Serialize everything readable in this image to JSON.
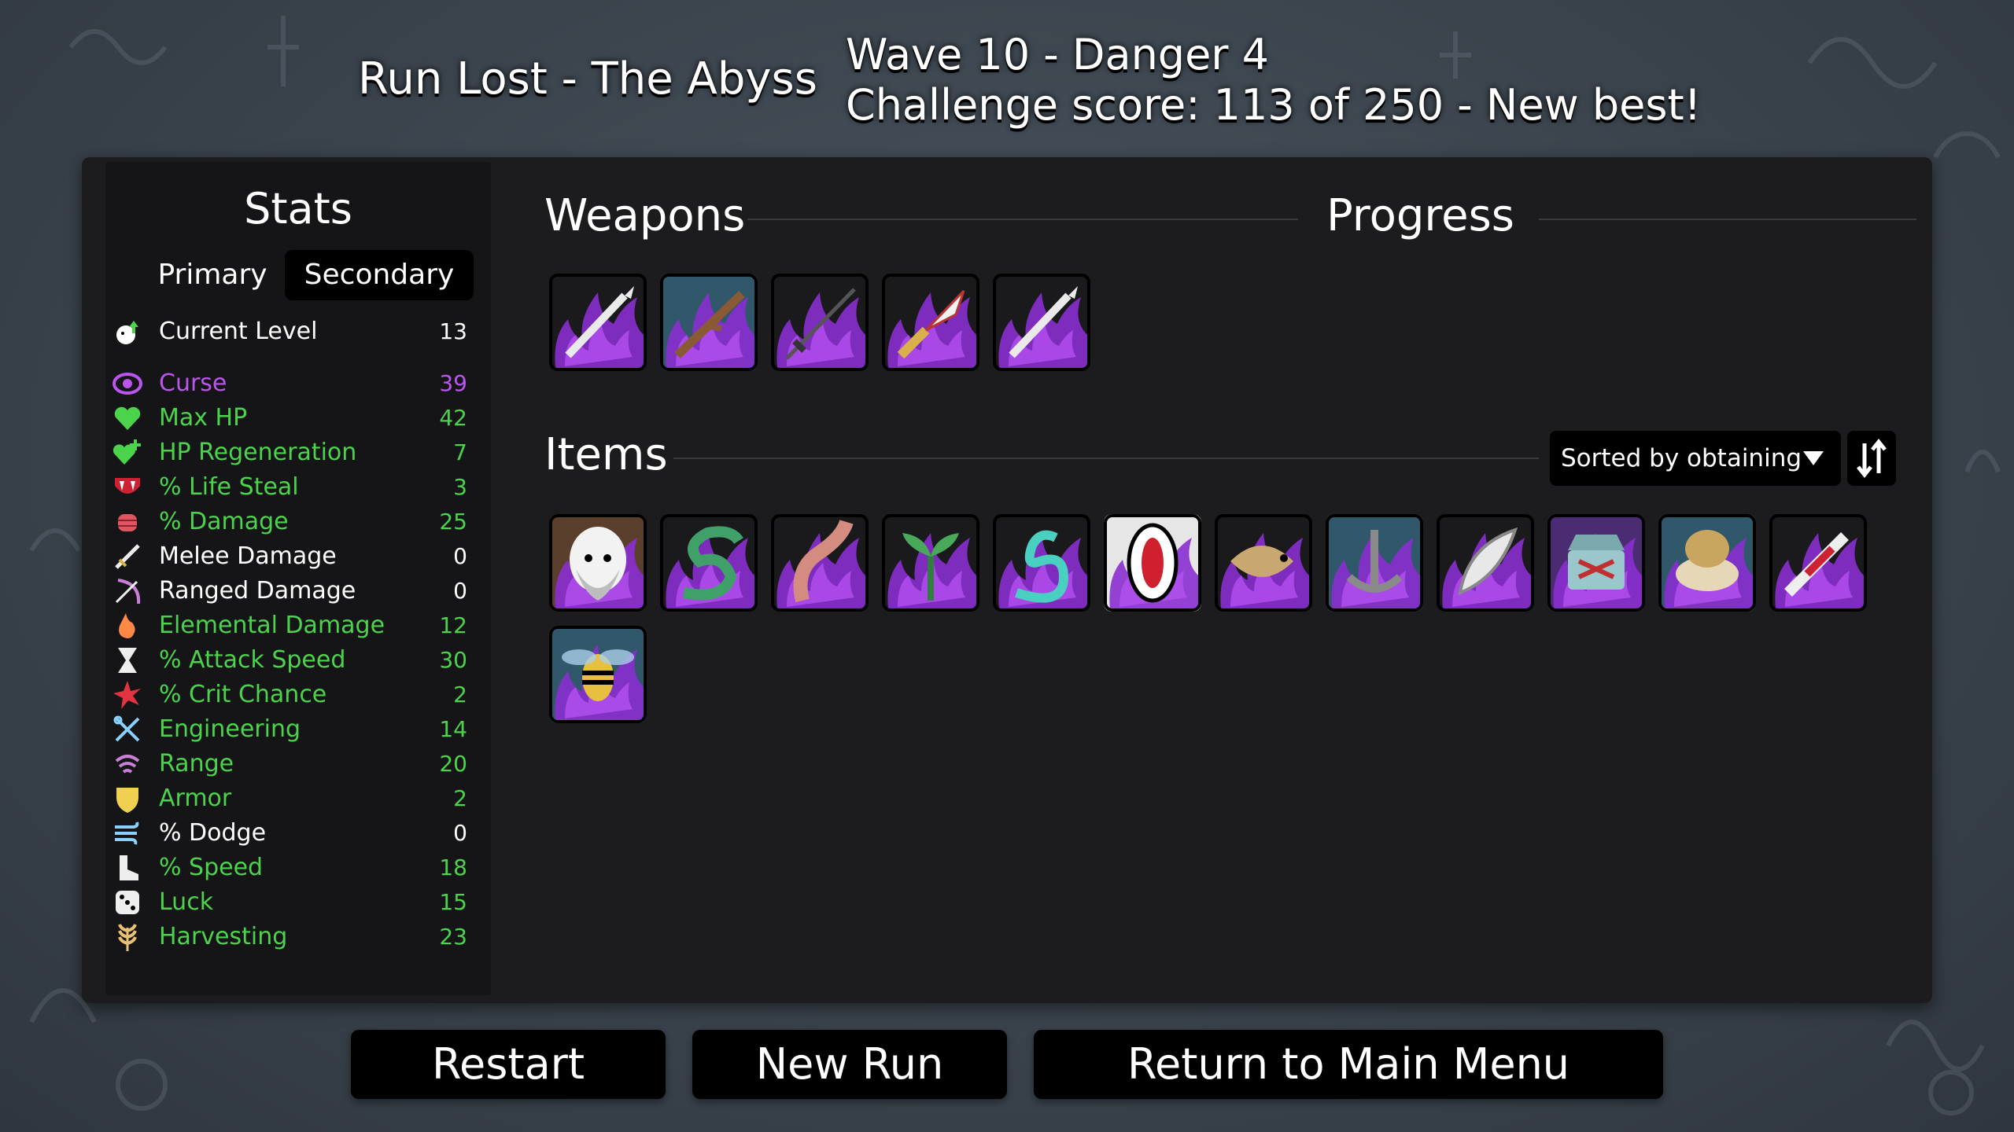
{
  "header": {
    "run_status": "Run Lost - The Abyss",
    "wave_line": "Wave 10 - Danger 4",
    "challenge_line": "Challenge score: 113 of 250 - New best!"
  },
  "stats": {
    "title": "Stats",
    "tabs": [
      {
        "label": "Primary",
        "selected": false
      },
      {
        "label": "Secondary",
        "selected": true
      }
    ],
    "rows": [
      {
        "label": "Current Level",
        "value": "13",
        "color": "white",
        "icon": "level-up-icon"
      },
      {
        "label": "Curse",
        "value": "39",
        "color": "purple",
        "icon": "curse-eye-icon"
      },
      {
        "label": "Max HP",
        "value": "42",
        "color": "green",
        "icon": "heart-icon"
      },
      {
        "label": "HP Regeneration",
        "value": "7",
        "color": "green",
        "icon": "heart-plus-icon"
      },
      {
        "label": "% Life Steal",
        "value": "3",
        "color": "green",
        "icon": "fangs-icon"
      },
      {
        "label": "% Damage",
        "value": "25",
        "color": "green",
        "icon": "fist-icon"
      },
      {
        "label": "Melee Damage",
        "value": "0",
        "color": "white",
        "icon": "sword-icon"
      },
      {
        "label": "Ranged Damage",
        "value": "0",
        "color": "white",
        "icon": "bow-icon"
      },
      {
        "label": "Elemental Damage",
        "value": "12",
        "color": "green",
        "icon": "flame-icon"
      },
      {
        "label": "% Attack Speed",
        "value": "30",
        "color": "green",
        "icon": "hourglass-icon"
      },
      {
        "label": "% Crit Chance",
        "value": "2",
        "color": "green",
        "icon": "crit-star-icon"
      },
      {
        "label": "Engineering",
        "value": "14",
        "color": "green",
        "icon": "wrench-icon"
      },
      {
        "label": "Range",
        "value": "20",
        "color": "green",
        "icon": "range-waves-icon"
      },
      {
        "label": "Armor",
        "value": "2",
        "color": "green",
        "icon": "shield-icon"
      },
      {
        "label": "% Dodge",
        "value": "0",
        "color": "white",
        "icon": "dodge-wind-icon"
      },
      {
        "label": "% Speed",
        "value": "18",
        "color": "green",
        "icon": "boot-icon"
      },
      {
        "label": "Luck",
        "value": "15",
        "color": "green",
        "icon": "dice-icon"
      },
      {
        "label": "Harvesting",
        "value": "23",
        "color": "green",
        "icon": "wheat-icon"
      }
    ]
  },
  "weapons": {
    "title": "Weapons",
    "slots": [
      {
        "name": "weapon-spear-icon",
        "bg": "dark"
      },
      {
        "name": "weapon-stick-icon",
        "bg": "blue"
      },
      {
        "name": "weapon-thin-sword-icon",
        "bg": "dark"
      },
      {
        "name": "weapon-lance-icon",
        "bg": "dark"
      },
      {
        "name": "weapon-spear-icon",
        "bg": "dark"
      }
    ]
  },
  "progress": {
    "title": "Progress"
  },
  "items": {
    "title": "Items",
    "sort_label": "Sorted by obtaining",
    "slots": [
      {
        "name": "item-bearded-egg-icon",
        "bg": "brown"
      },
      {
        "name": "item-snake-icon",
        "bg": "dark"
      },
      {
        "name": "item-tentacle-icon",
        "bg": "dark"
      },
      {
        "name": "item-sprout-icon",
        "bg": "dark"
      },
      {
        "name": "item-sea-serpent-icon",
        "bg": "dark"
      },
      {
        "name": "item-screaming-mouth-icon",
        "bg": "white"
      },
      {
        "name": "item-fish-icon",
        "bg": "dark"
      },
      {
        "name": "item-anchor-chain-icon",
        "bg": "blue"
      },
      {
        "name": "item-feather-quill-icon",
        "bg": "dark"
      },
      {
        "name": "item-treasure-chest-icon",
        "bg": "purple"
      },
      {
        "name": "item-clam-shell-icon",
        "bg": "blue"
      },
      {
        "name": "item-syringe-icon",
        "bg": "dark"
      },
      {
        "name": "item-wasp-icon",
        "bg": "blue"
      }
    ]
  },
  "buttons": {
    "restart": "Restart",
    "new_run": "New Run",
    "main_menu": "Return to Main Menu"
  }
}
